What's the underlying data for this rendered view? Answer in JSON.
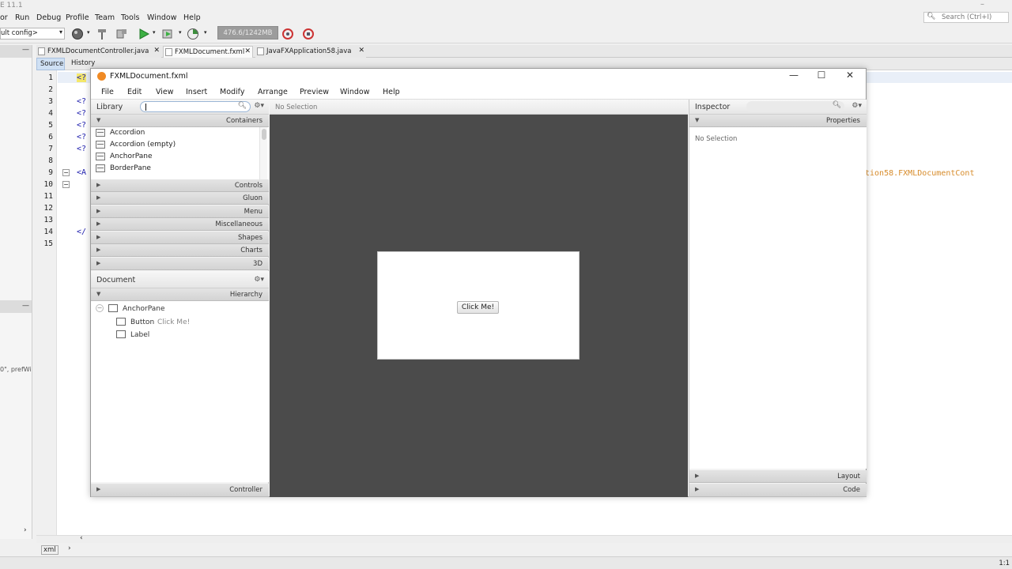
{
  "ide": {
    "title_fragment": "E 11.1",
    "menu": [
      "or",
      "Run",
      "Debug",
      "Profile",
      "Team",
      "Tools",
      "Window",
      "Help"
    ],
    "search_placeholder": "Search (Ctrl+I)",
    "config_value": "ult config>",
    "memory": "476.6/1242MB",
    "left_fragment": "0\", prefWi",
    "editor_tabs": [
      {
        "label": "FXMLDocumentController.java"
      },
      {
        "label": "FXMLDocument.fxml"
      },
      {
        "label": "JavaFXApplication58.java"
      }
    ],
    "source_label": "Source",
    "history_label": "History",
    "line_numbers": [
      "1",
      "2",
      "3",
      "4",
      "5",
      "6",
      "7",
      "8",
      "9",
      "10",
      "11",
      "12",
      "13",
      "14",
      "15"
    ],
    "code": {
      "l1": "<?",
      "l3": "<?",
      "l4": "<?",
      "l5": "<?",
      "l6": "<?",
      "l7": "<?",
      "l9": "<A",
      "l14": "</",
      "right_fragment": "tion58.FXMLDocumentCont"
    },
    "breadcrumb": "xml",
    "cursor_position": "1:1"
  },
  "scene_builder": {
    "title": "FXMLDocument.fxml",
    "menu": [
      "File",
      "Edit",
      "View",
      "Insert",
      "Modify",
      "Arrange",
      "Preview",
      "Window",
      "Help"
    ],
    "library": {
      "title": "Library",
      "sections": {
        "containers": "Containers",
        "controls": "Controls",
        "gluon": "Gluon",
        "menu": "Menu",
        "miscellaneous": "Miscellaneous",
        "shapes": "Shapes",
        "charts": "Charts",
        "three_d": "3D"
      },
      "items": [
        "Accordion",
        "Accordion  (empty)",
        "AnchorPane",
        "BorderPane"
      ]
    },
    "document": {
      "title": "Document",
      "hierarchy": "Hierarchy",
      "controller": "Controller",
      "tree": {
        "root": "AnchorPane",
        "button": "Button",
        "button_text": "Click Me!",
        "label": "Label"
      }
    },
    "content": {
      "selection": "No Selection",
      "button_text": "Click Me!"
    },
    "inspector": {
      "title": "Inspector",
      "properties": "Properties",
      "no_selection": "No Selection",
      "layout": "Layout",
      "code": "Code"
    }
  }
}
